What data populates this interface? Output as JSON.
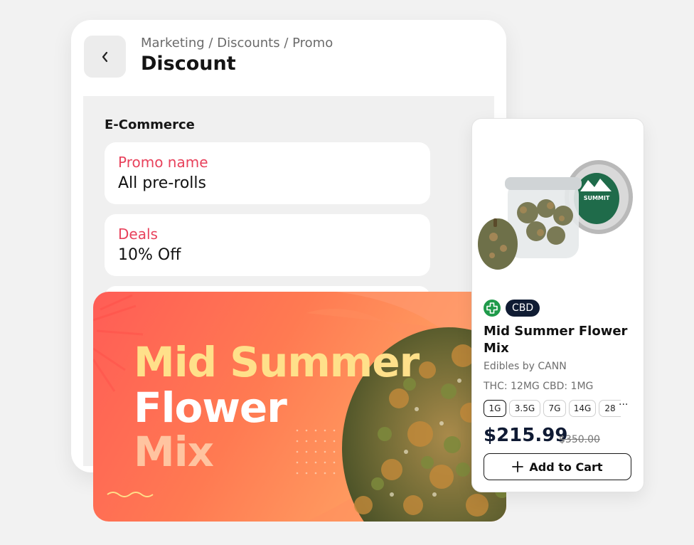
{
  "header": {
    "breadcrumb": "Marketing / Discounts / Promo",
    "title": "Discount"
  },
  "form": {
    "section_title": "E-Commerce",
    "promo_name_label": "Promo name",
    "promo_name_value": "All pre-rolls",
    "deals_label": "Deals",
    "deals_value": "10% Off"
  },
  "banner": {
    "line1": "Mid Summer",
    "line2": "Flower",
    "line3": "Mix",
    "colors": {
      "line1": "#ffe08a",
      "line2": "#ffffff",
      "line3": "#ffc4a0"
    }
  },
  "product": {
    "badge_icon": "cross-icon",
    "badge": "CBD",
    "name": "Mid Summer Flower Mix",
    "brand": "Edibles by CANN",
    "potency": "THC: 12MG  CBD: 1MG",
    "sizes": [
      "1G",
      "3.5G",
      "7G",
      "14G",
      "28"
    ],
    "selected_size": "1G",
    "more": "···",
    "price": "$215.99",
    "original_price": "$350.00",
    "add_to_cart": "Add to Cart",
    "jar_label": "SUMMIT"
  },
  "colors": {
    "accent_label": "#e8425c",
    "badge_dark": "#101c33",
    "badge_green": "#1f9a4a"
  }
}
